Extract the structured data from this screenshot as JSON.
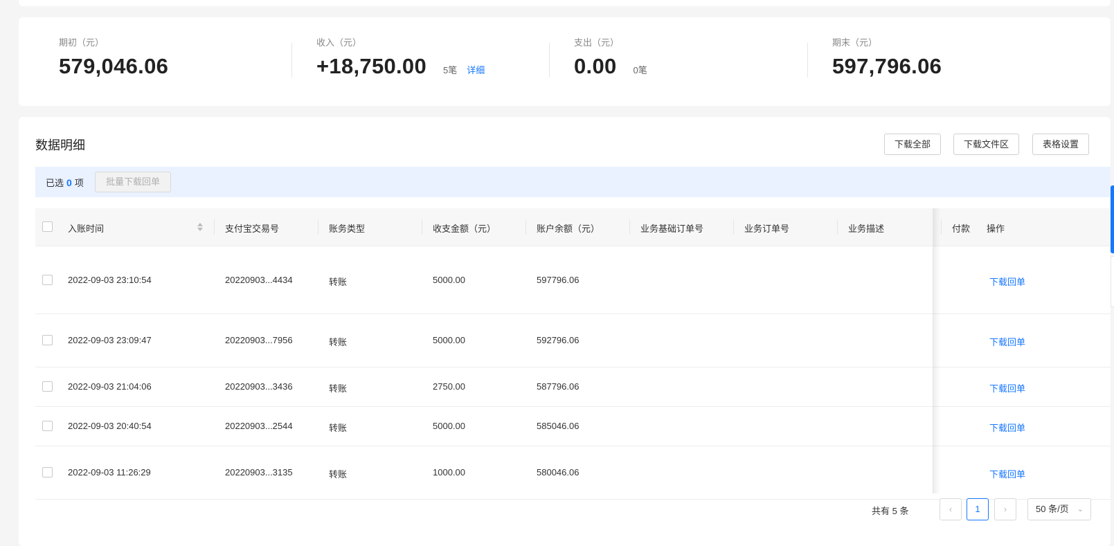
{
  "summary": {
    "opening": {
      "label": "期初（元）",
      "value": "579,046.06"
    },
    "income": {
      "label": "收入（元）",
      "value": "+18,750.00",
      "count": "5笔",
      "link": "详细"
    },
    "expense": {
      "label": "支出（元）",
      "value": "0.00",
      "count": "0笔"
    },
    "closing": {
      "label": "期末（元）",
      "value": "597,796.06"
    }
  },
  "detail": {
    "title": "数据明细",
    "buttons": {
      "download_all": "下载全部",
      "download_area": "下载文件区",
      "table_settings": "表格设置"
    },
    "selection": {
      "prefix": "已选",
      "count": "0",
      "suffix": "项",
      "batch_button": "批量下载回单"
    }
  },
  "table": {
    "columns": [
      "入账时间",
      "支付宝交易号",
      "账务类型",
      "收支金额（元）",
      "账户余额（元）",
      "业务基础订单号",
      "业务订单号",
      "业务描述",
      "付款",
      "操作"
    ],
    "rows": [
      {
        "time": "2022-09-03 23:10:54",
        "trade_no": "20220903...4434",
        "type": "转账",
        "amount": "5000.00",
        "balance": "597796.06",
        "action": "下载回单"
      },
      {
        "time": "2022-09-03 23:09:47",
        "trade_no": "20220903...7956",
        "type": "转账",
        "amount": "5000.00",
        "balance": "592796.06",
        "action": "下载回单"
      },
      {
        "time": "2022-09-03 21:04:06",
        "trade_no": "20220903...3436",
        "type": "转账",
        "amount": "2750.00",
        "balance": "587796.06",
        "action": "下载回单"
      },
      {
        "time": "2022-09-03 20:40:54",
        "trade_no": "20220903...2544",
        "type": "转账",
        "amount": "5000.00",
        "balance": "585046.06",
        "action": "下载回单"
      },
      {
        "time": "2022-09-03 11:26:29",
        "trade_no": "20220903...3135",
        "type": "转账",
        "amount": "1000.00",
        "balance": "580046.06",
        "action": "下载回单"
      }
    ]
  },
  "pagination": {
    "total": "共有 5 条",
    "prev_icon": "‹",
    "current_page": "1",
    "next_icon": "›",
    "page_size": "50 条/页",
    "page_size_icon": "⌄"
  },
  "colors": {
    "accent": "#1677ff",
    "selection_bg": "#eaf2ff",
    "page_bg": "#f5f5f5"
  }
}
